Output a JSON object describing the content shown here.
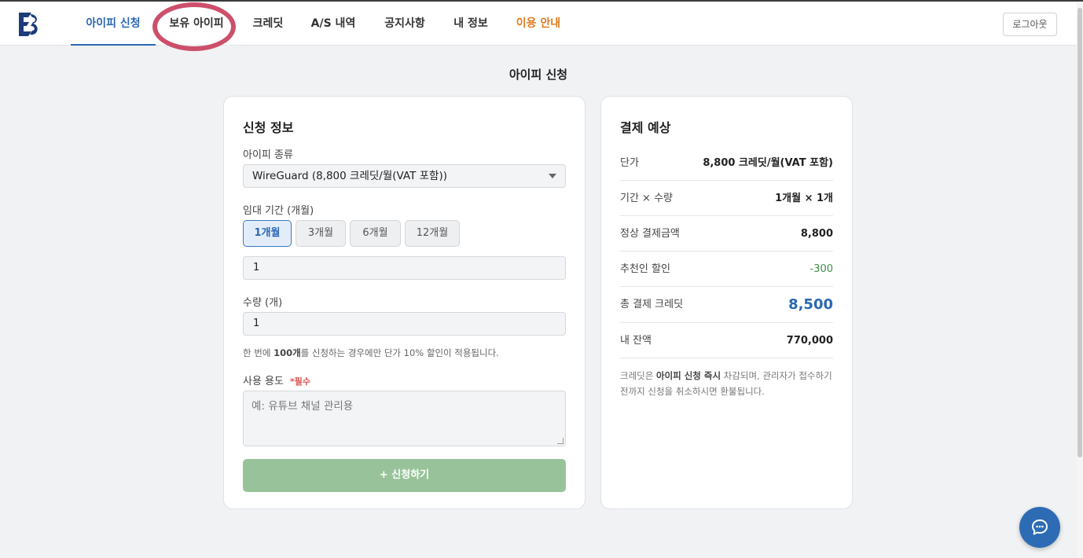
{
  "brand": {
    "logo_text": "EB"
  },
  "nav": {
    "items": [
      {
        "label": "아이피 신청"
      },
      {
        "label": "보유 아이피"
      },
      {
        "label": "크레딧"
      },
      {
        "label": "A/S 내역"
      },
      {
        "label": "공지사항"
      },
      {
        "label": "내 정보"
      },
      {
        "label": "이용 안내"
      }
    ],
    "logout_label": "로그아웃"
  },
  "page": {
    "title": "아이피 신청"
  },
  "form": {
    "title": "신청 정보",
    "ip_type_label": "아이피 종류",
    "ip_type_value": "WireGuard (8,800 크레딧/월(VAT 포함))",
    "period_label": "임대 기간 (개월)",
    "period_options": [
      {
        "label": "1개월"
      },
      {
        "label": "3개월"
      },
      {
        "label": "6개월"
      },
      {
        "label": "12개월"
      }
    ],
    "period_selected": "1개월",
    "period_value": "1",
    "quantity_label": "수량 (개)",
    "quantity_value": "1",
    "hint_prefix": "한 번에 ",
    "hint_bold": "100개",
    "hint_suffix": "를 신청하는 경우에만 단가 10% 할인이 적용됩니다.",
    "purpose_label": "사용 용도",
    "purpose_required": "*필수",
    "purpose_placeholder": "예: 유튜브 채널 관리용",
    "submit_label": "+ 신청하기"
  },
  "summary": {
    "title": "결제 예상",
    "rows": [
      {
        "label": "단가",
        "value": "8,800 크레딧/월(VAT 포함)"
      },
      {
        "label": "기간 × 수량",
        "value": "1개월 × 1개"
      },
      {
        "label": "정상 결제금액",
        "value": "8,800"
      },
      {
        "label": "추천인 할인",
        "value": "-300"
      },
      {
        "label": "총 결제 크레딧",
        "value": "8,500"
      },
      {
        "label": "내 잔액",
        "value": "770,000"
      }
    ],
    "note_prefix": "크레딧은 ",
    "note_bold": "아이피 신청 즉시",
    "note_suffix": " 차감되며, 관리자가 접수하기 전까지 신청을 취소하시면 환불됩니다."
  },
  "colors": {
    "accent": "#2a67b3",
    "orange": "#e07a1f",
    "discount": "#3e8f47",
    "submit": "#98c39a",
    "highlight_ring": "#cc4f6b"
  },
  "icons": {
    "chat": "chat-bubble-icon",
    "caret": "chevron-down-icon"
  }
}
